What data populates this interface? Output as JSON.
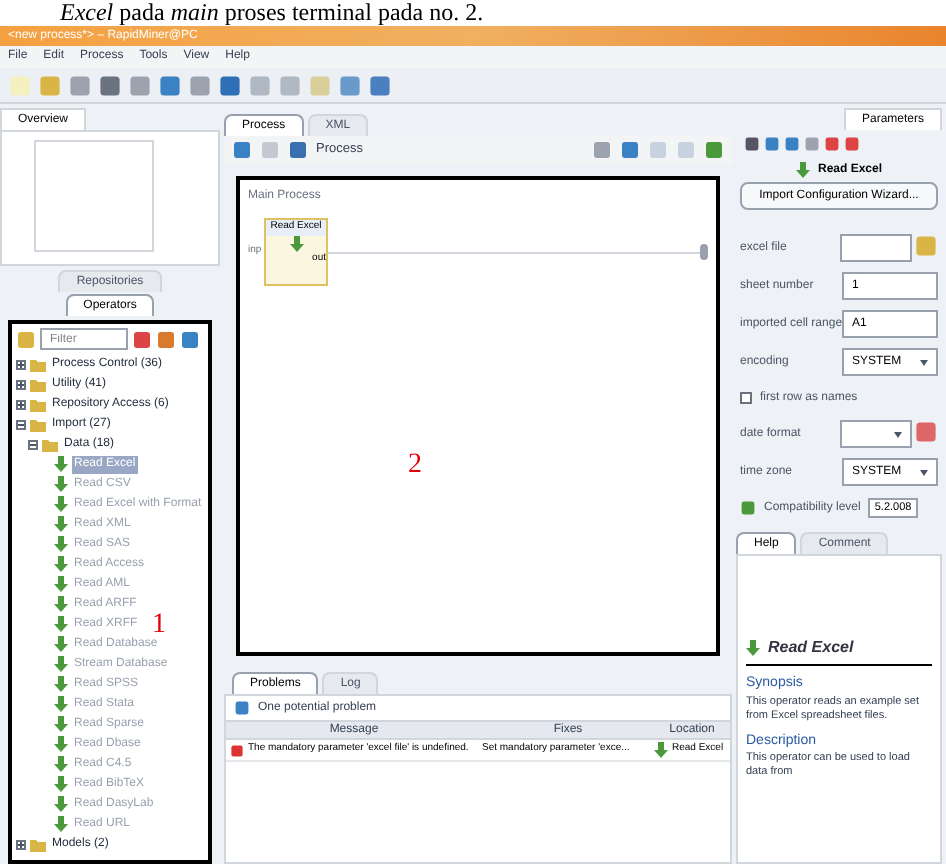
{
  "caption": "*Excel* pada *main* proses terminal pada no. 2.",
  "window": {
    "title": "<new process*> – RapidMiner@PC"
  },
  "menu": [
    "File",
    "Edit",
    "Process",
    "Tools",
    "View",
    "Help"
  ],
  "overview": {
    "tab": "Overview"
  },
  "left_tabs": [
    {
      "label": "Repositories",
      "selected": false
    },
    {
      "label": "Operators",
      "selected": true
    }
  ],
  "search": {
    "placeholder": "Filter"
  },
  "tree": [
    {
      "label": "Process Control (36)",
      "expanded": false,
      "selected": false
    },
    {
      "label": "Utility (41)",
      "expanded": false,
      "selected": false
    },
    {
      "label": "Repository Access (6)",
      "expanded": false,
      "selected": false
    },
    {
      "label": "Import (27)",
      "expanded": true,
      "selected": false,
      "children": [
        {
          "label": "Data (18)",
          "expanded": true,
          "selected": false,
          "children": [
            {
              "label": "Read Excel",
              "selected": true
            },
            {
              "label": "Read CSV",
              "selected": false
            },
            {
              "label": "Read Excel with Format",
              "selected": false
            },
            {
              "label": "Read XML",
              "selected": false
            },
            {
              "label": "Read SAS",
              "selected": false
            },
            {
              "label": "Read Access",
              "selected": false
            },
            {
              "label": "Read AML",
              "selected": false
            },
            {
              "label": "Read ARFF",
              "selected": false
            },
            {
              "label": "Read XRFF",
              "selected": false
            },
            {
              "label": "Read Database",
              "selected": false
            },
            {
              "label": "Stream Database",
              "selected": false
            },
            {
              "label": "Read SPSS",
              "selected": false
            },
            {
              "label": "Read Stata",
              "selected": false
            },
            {
              "label": "Read Sparse",
              "selected": false
            },
            {
              "label": "Read Dbase",
              "selected": false
            },
            {
              "label": "Read C4.5",
              "selected": false
            },
            {
              "label": "Read BibTeX",
              "selected": false
            },
            {
              "label": "Read DasyLab",
              "selected": false
            },
            {
              "label": "Read URL",
              "selected": false
            }
          ]
        }
      ]
    },
    {
      "label": "Models (2)",
      "expanded": false,
      "selected": false
    }
  ],
  "center_tabs": [
    {
      "label": "Process",
      "selected": true
    },
    {
      "label": "XML",
      "selected": false
    }
  ],
  "breadcrumb": "Process",
  "canvas": {
    "title": "Main Process",
    "operator": "Read Excel",
    "port_in": "inp",
    "port_out": "out"
  },
  "annotations": [
    "1",
    "2"
  ],
  "bottom_tabs": [
    {
      "label": "Problems",
      "selected": true
    },
    {
      "label": "Log",
      "selected": false
    }
  ],
  "problems": {
    "summary": "One potential problem",
    "columns": [
      "Message",
      "Fixes",
      "Location"
    ],
    "rows": [
      {
        "message": "The mandatory parameter 'excel file' is undefined.",
        "fix": "Set mandatory parameter 'exce...",
        "location": "Read Excel"
      }
    ]
  },
  "parameters": {
    "tab": "Parameters",
    "operator": "Read Excel",
    "wizard_button": "Import Configuration Wizard...",
    "items": [
      {
        "kind": "file",
        "label": "excel file",
        "value": ""
      },
      {
        "kind": "text",
        "label": "sheet number",
        "value": "1"
      },
      {
        "kind": "text",
        "label": "imported cell range",
        "value": "A1"
      },
      {
        "kind": "select",
        "label": "encoding",
        "value": "SYSTEM"
      },
      {
        "kind": "checkbox",
        "label": "first row as names",
        "checked": false
      },
      {
        "kind": "combo",
        "label": "date format",
        "value": ""
      },
      {
        "kind": "select",
        "label": "time zone",
        "value": "SYSTEM"
      },
      {
        "kind": "spinner",
        "label": "Compatibility level",
        "value": "5.2.008"
      }
    ]
  },
  "help_tabs": [
    {
      "label": "Help",
      "selected": true
    },
    {
      "label": "Comment",
      "selected": false
    }
  ],
  "help": {
    "title": "Read Excel",
    "sections": [
      {
        "heading": "Synopsis",
        "text": "This operator reads an example set from Excel spreadsheet files."
      },
      {
        "heading": "Description",
        "text": "This operator can be used to load data from"
      }
    ]
  }
}
